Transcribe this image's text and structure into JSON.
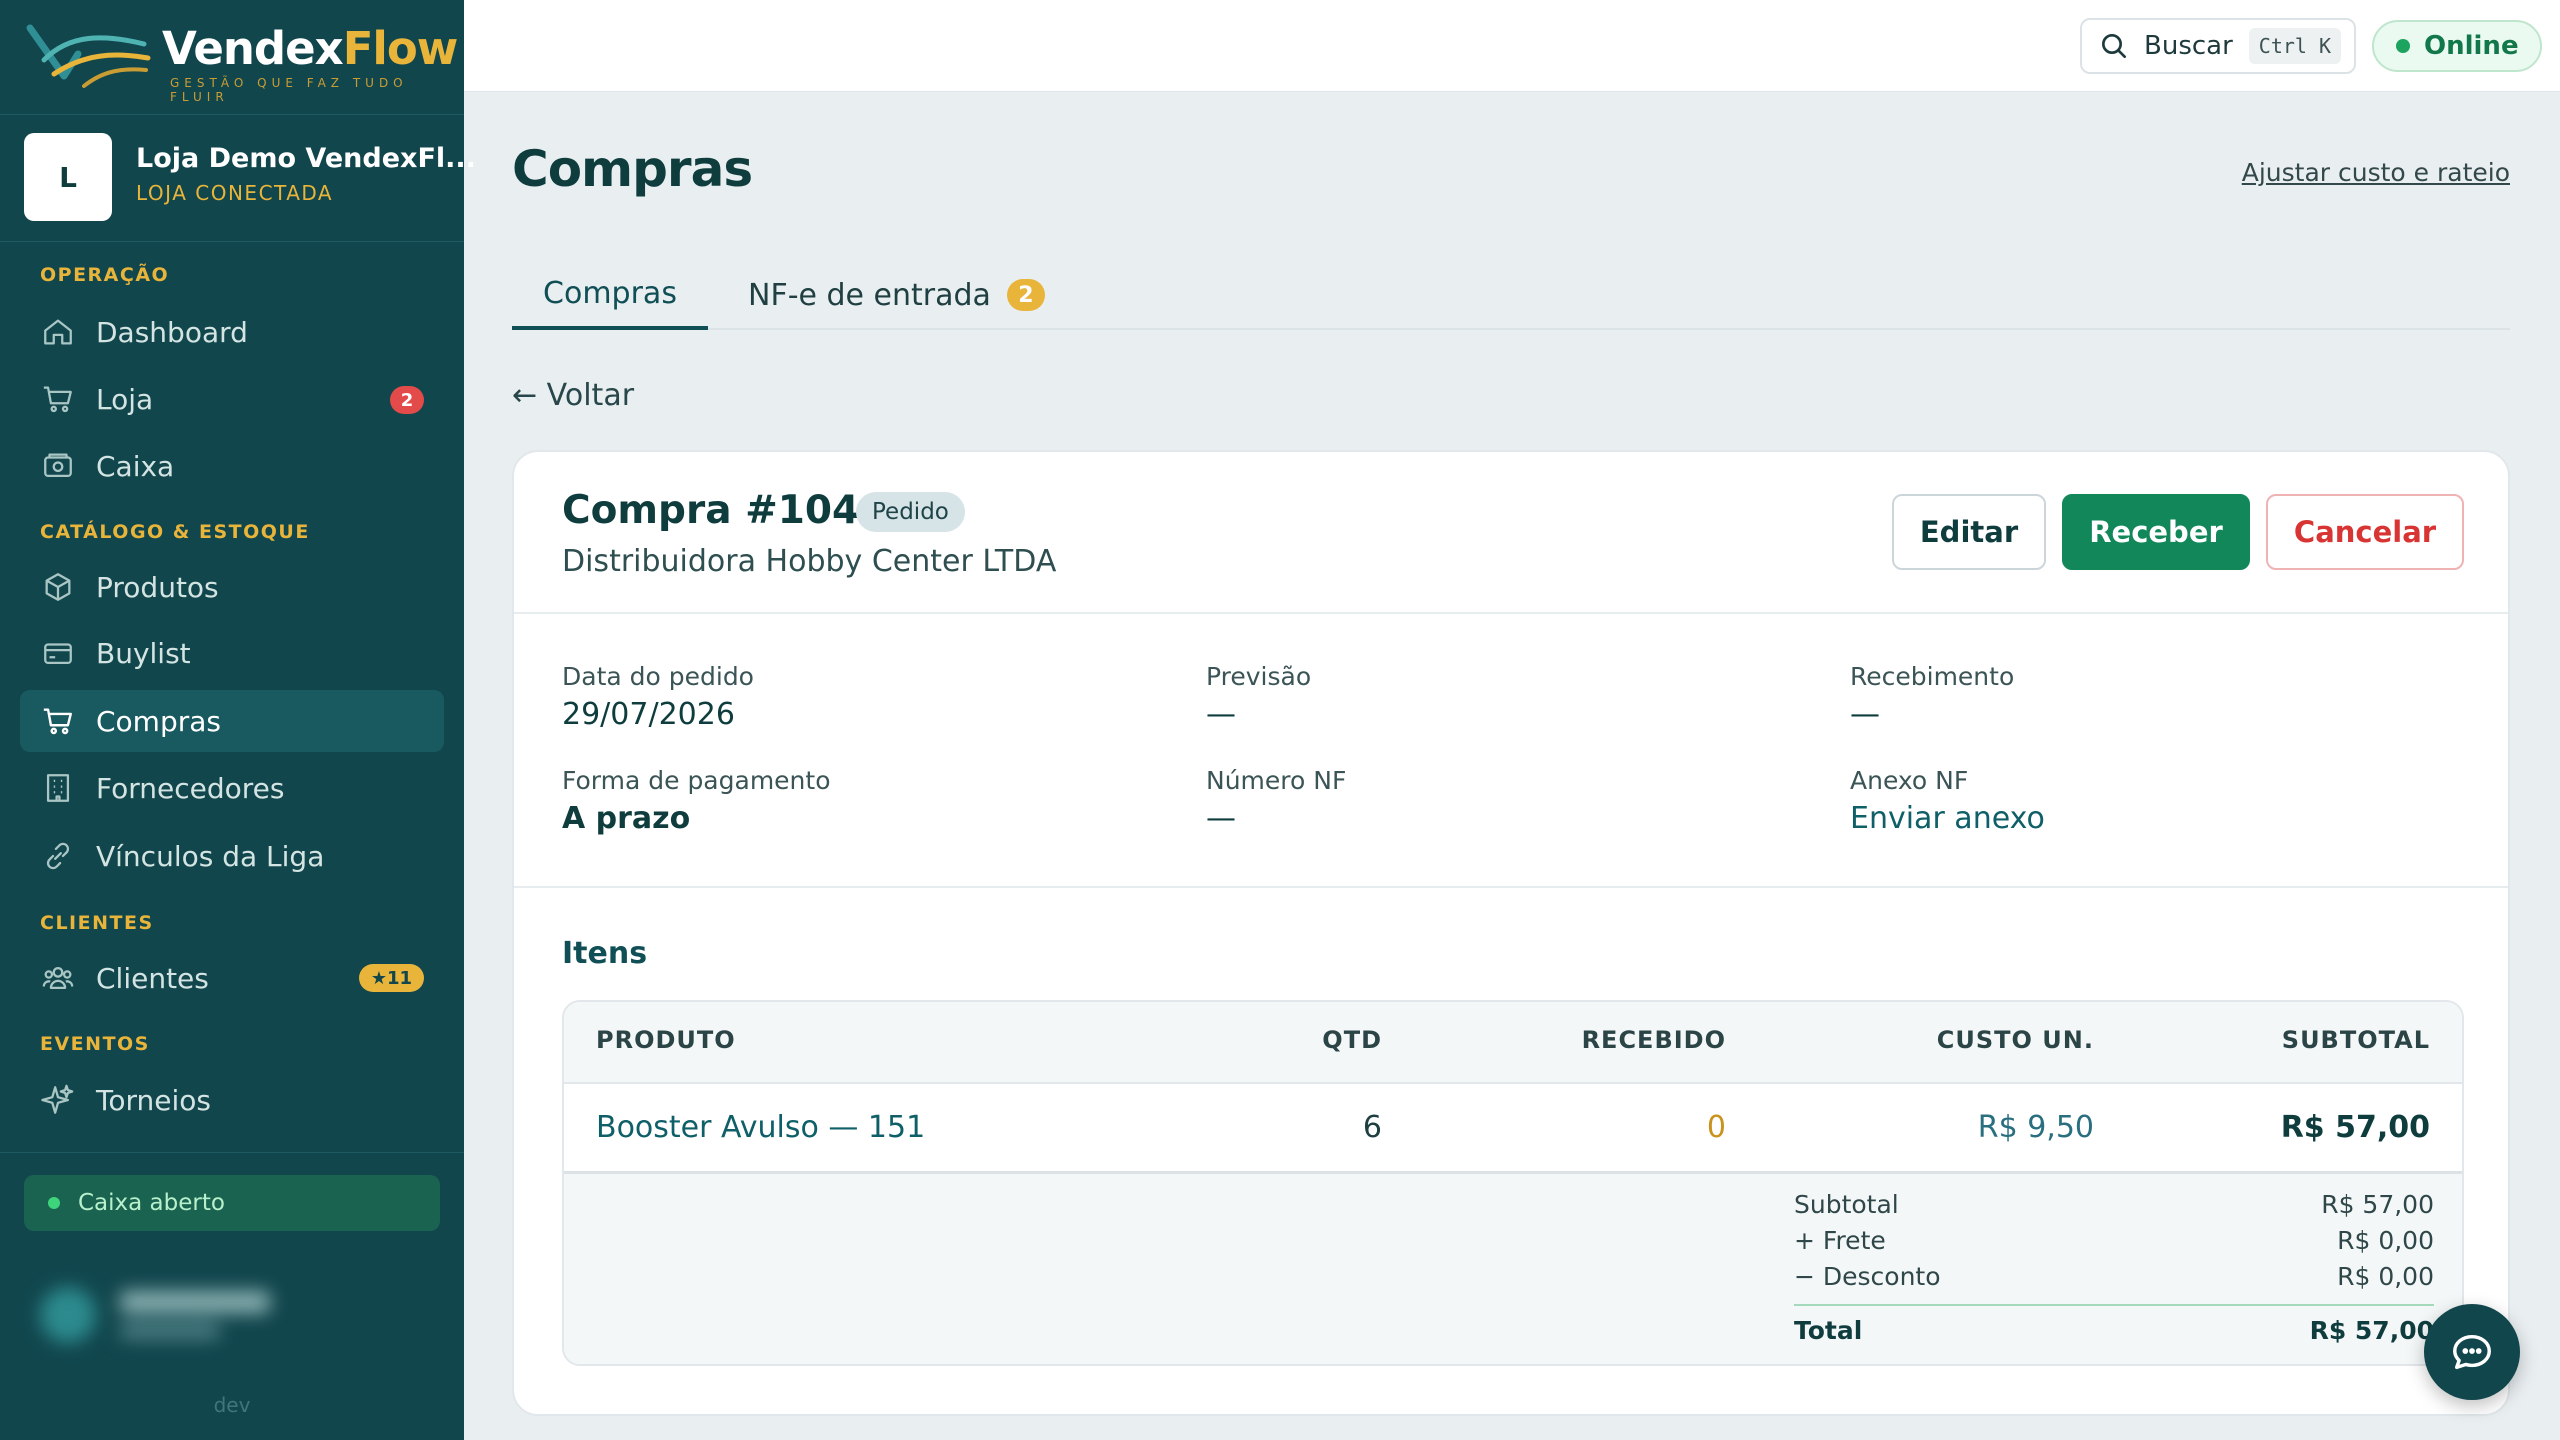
{
  "brand": {
    "name_main": "Vendex",
    "name_accent": "Flow",
    "tagline": "GESTÃO QUE FAZ TUDO FLUIR",
    "colors": {
      "sidebar": "#11464d",
      "accent": "#e8b43a",
      "primary": "#12875a",
      "danger": "#d93434"
    }
  },
  "store": {
    "avatar_letter": "L",
    "name": "Loja Demo VendexFl...",
    "status": "LOJA CONECTADA"
  },
  "sidebar": {
    "sections": {
      "operacao": "OPERAÇÃO",
      "catalogo": "CATÁLOGO & ESTOQUE",
      "clientes": "CLIENTES",
      "eventos": "EVENTOS"
    },
    "items": [
      {
        "label": "Dashboard",
        "icon": "home-icon"
      },
      {
        "label": "Loja",
        "icon": "cart-icon",
        "badge": "2"
      },
      {
        "label": "Caixa",
        "icon": "cash-register-icon"
      },
      {
        "label": "Produtos",
        "icon": "box-icon"
      },
      {
        "label": "Buylist",
        "icon": "card-icon"
      },
      {
        "label": "Compras",
        "icon": "cart-icon",
        "active": true
      },
      {
        "label": "Fornecedores",
        "icon": "building-icon"
      },
      {
        "label": "Vínculos da Liga",
        "icon": "link-icon"
      },
      {
        "label": "Clientes",
        "icon": "users-icon",
        "badge": "★11"
      },
      {
        "label": "Torneios",
        "icon": "sparkle-icon"
      }
    ],
    "cash_status": "Caixa aberto",
    "env": "dev"
  },
  "topbar": {
    "search_label": "Buscar",
    "search_shortcut": "Ctrl K",
    "online_label": "Online"
  },
  "page": {
    "title": "Compras",
    "adjust_link": "Ajustar custo e rateio",
    "tabs": [
      {
        "label": "Compras",
        "active": true
      },
      {
        "label": "NF-e de entrada",
        "badge": "2"
      }
    ],
    "back_label": "← Voltar"
  },
  "order": {
    "title": "Compra #1044",
    "status": "Pedido",
    "supplier": "Distribuidora Hobby Center LTDA",
    "actions": {
      "edit": "Editar",
      "receive": "Receber",
      "cancel": "Cancelar"
    },
    "fields": {
      "order_date": {
        "label": "Data do pedido",
        "value": "29/07/2026"
      },
      "forecast": {
        "label": "Previsão",
        "value": "—"
      },
      "receipt": {
        "label": "Recebimento",
        "value": "—"
      },
      "payment": {
        "label": "Forma de pagamento",
        "value": "A prazo"
      },
      "nf_number": {
        "label": "Número NF",
        "value": "—"
      },
      "nf_attachment": {
        "label": "Anexo NF",
        "value": "Enviar anexo"
      }
    },
    "items_title": "Itens",
    "table": {
      "columns": [
        "PRODUTO",
        "QTD",
        "RECEBIDO",
        "CUSTO UN.",
        "SUBTOTAL"
      ],
      "rows": [
        {
          "product": "Booster Avulso — 151",
          "qty": "6",
          "received": "0",
          "unit_cost": "R$ 9,50",
          "subtotal": "R$ 57,00"
        }
      ]
    },
    "summary": {
      "subtotal": {
        "label": "Subtotal",
        "value": "R$ 57,00"
      },
      "freight": {
        "label": "+ Frete",
        "value": "R$ 0,00"
      },
      "discount": {
        "label": "− Desconto",
        "value": "R$ 0,00"
      },
      "total": {
        "label": "Total",
        "value": "R$ 57,00"
      }
    }
  }
}
